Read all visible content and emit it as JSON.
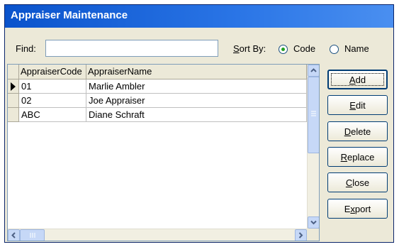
{
  "window": {
    "title": "Appraiser Maintenance"
  },
  "find": {
    "label": "Find:",
    "value": ""
  },
  "sort": {
    "label": "Sort By:",
    "options": [
      {
        "label": "Code",
        "selected": true
      },
      {
        "label": "Name",
        "selected": false
      }
    ]
  },
  "grid": {
    "columns": [
      "AppraiserCode",
      "AppraiserName"
    ],
    "rows": [
      {
        "code": "01",
        "name": "Marlie Ambler",
        "current": true
      },
      {
        "code": "02",
        "name": "Joe Appraiser",
        "current": false
      },
      {
        "code": "ABC",
        "name": "Diane Schraft",
        "current": false
      }
    ]
  },
  "buttons": {
    "add": {
      "pre": "",
      "key": "A",
      "post": "dd"
    },
    "edit": {
      "pre": "",
      "key": "E",
      "post": "dit"
    },
    "delete": {
      "pre": "",
      "key": "D",
      "post": "elete"
    },
    "replace": {
      "pre": "",
      "key": "R",
      "post": "eplace"
    },
    "close": {
      "pre": "",
      "key": "C",
      "post": "lose"
    },
    "export": {
      "pre": "E",
      "key": "x",
      "post": "port"
    }
  },
  "colors": {
    "titlebar": "#0a53cc",
    "face": "#ece9d8",
    "accent": "#21a121"
  },
  "icons": [
    "row-pointer-icon",
    "scroll-up-arrow-icon",
    "scroll-down-arrow-icon",
    "scroll-left-arrow-icon",
    "scroll-right-arrow-icon",
    "scroll-grip-icon"
  ]
}
